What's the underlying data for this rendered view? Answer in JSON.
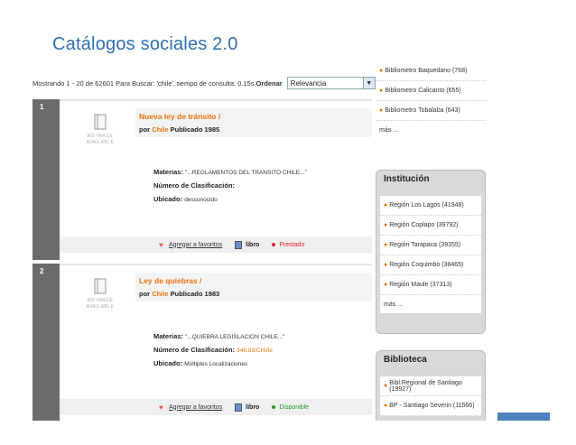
{
  "slide": {
    "title": "Catálogos sociales 2.0"
  },
  "results_bar": {
    "summary": "Mostrando 1 - 20 de 62601 Para Buscar: 'chile', tiempo de consulta: 0.15s",
    "order_label": "Ordenar",
    "order_value": "Relevancia"
  },
  "results": [
    {
      "rank": "1",
      "no_image_line1": "NO IMAGE",
      "no_image_line2": "AVAILABLE",
      "title": "Nueva ley de tránsito /",
      "by": "por",
      "author": "Chile",
      "published": "Publicado 1985",
      "materias_label": "Materias:",
      "materias_value": "\"...REGLAMENTOS DEL TRANSITO CHILE...\"",
      "clasif_label": "Número de Clasificación:",
      "clasif_value": "",
      "ubicado_label": "Ubicado:",
      "ubicado_value": "desconocido",
      "fav_label": "Agregar a favoritos",
      "format_label": "libro",
      "status": "Prestado"
    },
    {
      "rank": "2",
      "no_image_line1": "NO IMAGE",
      "no_image_line2": "AVAILABLE",
      "title": "Ley de quiebras /",
      "by": "por",
      "author": "Chile",
      "published": "Publicado 1983",
      "materias_label": "Materias:",
      "materias_value": "\"...QUIEBRA LEGISLACION CHILE...\"",
      "clasif_label": "Número de Clasificación:",
      "clasif_value": "346.83/CHI/le",
      "ubicado_label": "Ubicado:",
      "ubicado_value": "Múltiples Localizaciones",
      "fav_label": "Agregar a favoritos",
      "format_label": "libro",
      "status": "Disponible"
    }
  ],
  "sidebar_top": {
    "items": [
      "Bibliometro Baquedano (768)",
      "Bibliometro Calicanto (655)",
      "Bibliometro Tobalaba (643)"
    ],
    "more": "más ..."
  },
  "institucion": {
    "title": "Institución",
    "items": [
      "Región Los Lagos (41948)",
      "Región Coplapo (39792)",
      "Región Tarapaca (39355)",
      "Región Coquimbo (38465)",
      "Región Maule (37313)"
    ],
    "more": "más ..."
  },
  "biblioteca": {
    "title": "Biblioteca",
    "items": [
      "Bibl.Regional de Santiago (19927)",
      "BP - Santiago Severin (11566)"
    ]
  },
  "colors": {
    "link": "#e8740c",
    "title": "#2f6fb3",
    "accent": "#4f81bd",
    "available": "#2a9a2a",
    "loaned": "#d23"
  }
}
